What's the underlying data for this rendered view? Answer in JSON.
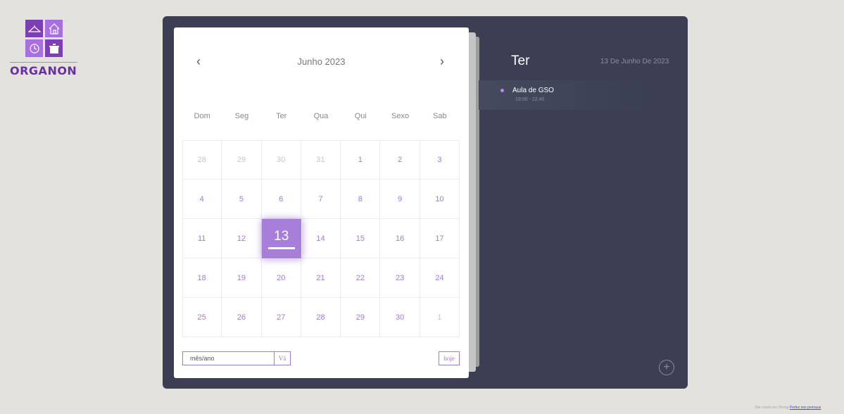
{
  "logo": {
    "text": "ORGANON",
    "icons": [
      "hanger-icon",
      "house-icon",
      "clock-icon",
      "pot-icon"
    ]
  },
  "calendar": {
    "month_title": "Junho 2023",
    "prev_icon": "‹",
    "next_icon": "›",
    "weekdays": [
      "Dom",
      "Seg",
      "Ter",
      "Qua",
      "Qui",
      "Sexo",
      "Sab"
    ],
    "weeks": [
      [
        {
          "d": "28",
          "o": true
        },
        {
          "d": "29",
          "o": true
        },
        {
          "d": "30",
          "o": true
        },
        {
          "d": "31",
          "o": true
        },
        {
          "d": "1"
        },
        {
          "d": "2"
        },
        {
          "d": "3"
        }
      ],
      [
        {
          "d": "4"
        },
        {
          "d": "5"
        },
        {
          "d": "6"
        },
        {
          "d": "7"
        },
        {
          "d": "8"
        },
        {
          "d": "9"
        },
        {
          "d": "10"
        }
      ],
      [
        {
          "d": "11"
        },
        {
          "d": "12"
        },
        {
          "d": "13",
          "s": true
        },
        {
          "d": "14"
        },
        {
          "d": "15"
        },
        {
          "d": "16"
        },
        {
          "d": "17"
        }
      ],
      [
        {
          "d": "18"
        },
        {
          "d": "19"
        },
        {
          "d": "20"
        },
        {
          "d": "21"
        },
        {
          "d": "22"
        },
        {
          "d": "23"
        },
        {
          "d": "24"
        }
      ],
      [
        {
          "d": "25"
        },
        {
          "d": "26"
        },
        {
          "d": "27"
        },
        {
          "d": "28"
        },
        {
          "d": "29"
        },
        {
          "d": "30"
        },
        {
          "d": "1",
          "o": true
        }
      ]
    ],
    "goto_value": "mês/ano",
    "go_label": "Vá",
    "today_label": "hoje"
  },
  "day_panel": {
    "day_name": "Ter",
    "full_date": "13 De Junho De 2023",
    "events": [
      {
        "title": "Aula de GSO",
        "time": "19:00 - 22:40"
      }
    ],
    "add_label": "+"
  },
  "footer": {
    "credit_text": "Site criado por Strong",
    "credit_link": "Perfez nos perinaus"
  },
  "colors": {
    "accent": "#a77fdb",
    "panel": "#3c3f53",
    "background": "#e3e2dd",
    "brand": "#6a2fa6"
  }
}
